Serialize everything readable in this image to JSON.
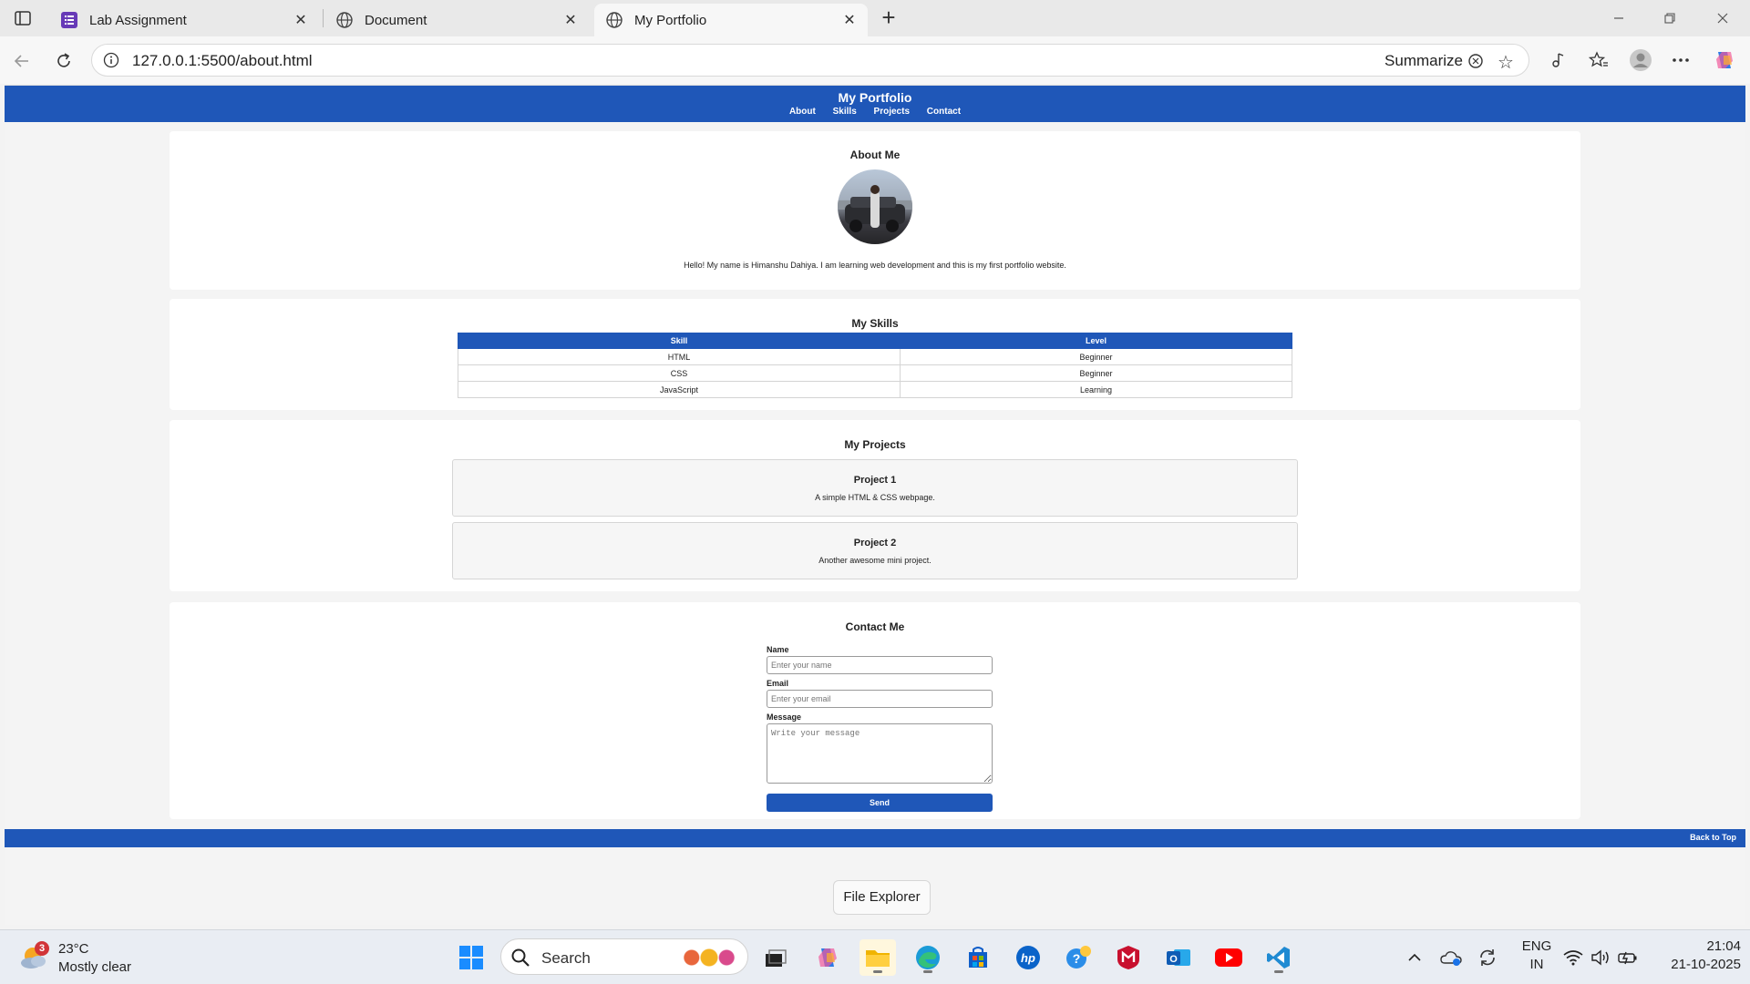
{
  "browser": {
    "tabs": [
      {
        "title": "Lab Assignment",
        "favicon": "forms-icon"
      },
      {
        "title": "Document",
        "favicon": "globe-icon"
      },
      {
        "title": "My Portfolio",
        "favicon": "globe-icon",
        "active": true
      }
    ],
    "url": "127.0.0.1:5500/about.html",
    "summarize_label": "Summarize"
  },
  "site": {
    "title": "My Portfolio",
    "nav": [
      "About",
      "Skills",
      "Projects",
      "Contact"
    ],
    "about": {
      "heading": "About Me",
      "text": "Hello! My name is Himanshu Dahiya. I am learning web development and this is my first portfolio website."
    },
    "skills": {
      "heading": "My Skills",
      "columns": [
        "Skill",
        "Level"
      ],
      "rows": [
        [
          "HTML",
          "Beginner"
        ],
        [
          "CSS",
          "Beginner"
        ],
        [
          "JavaScript",
          "Learning"
        ]
      ]
    },
    "projects": {
      "heading": "My Projects",
      "items": [
        {
          "title": "Project 1",
          "desc": "A simple HTML & CSS webpage."
        },
        {
          "title": "Project 2",
          "desc": "Another awesome mini project."
        }
      ]
    },
    "contact": {
      "heading": "Contact Me",
      "name_label": "Name",
      "name_placeholder": "Enter your name",
      "email_label": "Email",
      "email_placeholder": "Enter your email",
      "message_label": "Message",
      "message_placeholder": "Write your message",
      "send_label": "Send"
    },
    "footer_link": "Back to Top"
  },
  "tooltip": "File Explorer",
  "taskbar": {
    "weather_badge": "3",
    "temperature": "23°C",
    "condition": "Mostly clear",
    "search_label": "Search",
    "lang_line1": "ENG",
    "lang_line2": "IN",
    "time": "21:04",
    "date": "21-10-2025"
  },
  "colors": {
    "brand_blue": "#1f57b8"
  }
}
